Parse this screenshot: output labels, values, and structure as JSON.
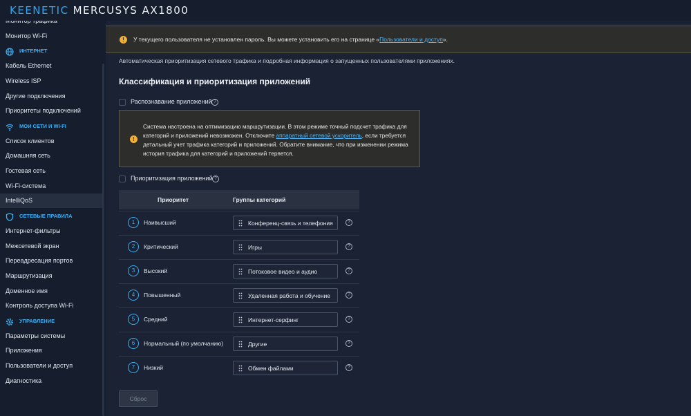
{
  "brand": {
    "part1": "KEENETIC",
    "part2": "MERCUSYS AX1800"
  },
  "sidebar": {
    "items": [
      {
        "type": "item",
        "label": "Монитор трафика"
      },
      {
        "type": "item",
        "label": "Монитор Wi-Fi"
      },
      {
        "type": "section",
        "label": "ИНТЕРНЕТ",
        "icon": "globe-icon"
      },
      {
        "type": "item",
        "label": "Кабель Ethernet"
      },
      {
        "type": "item",
        "label": "Wireless ISP"
      },
      {
        "type": "item",
        "label": "Другие подключения"
      },
      {
        "type": "item",
        "label": "Приоритеты подключений"
      },
      {
        "type": "section",
        "label": "МОИ СЕТИ И WI-FI",
        "icon": "wifi-icon"
      },
      {
        "type": "item",
        "label": "Список клиентов"
      },
      {
        "type": "item",
        "label": "Домашняя сеть"
      },
      {
        "type": "item",
        "label": "Гостевая сеть"
      },
      {
        "type": "item",
        "label": "Wi-Fi-система"
      },
      {
        "type": "item",
        "label": "IntelliQoS",
        "active": true
      },
      {
        "type": "section",
        "label": "СЕТЕВЫЕ ПРАВИЛА",
        "icon": "shield-icon"
      },
      {
        "type": "item",
        "label": "Интернет-фильтры"
      },
      {
        "type": "item",
        "label": "Межсетевой экран"
      },
      {
        "type": "item",
        "label": "Переадресация портов"
      },
      {
        "type": "item",
        "label": "Маршрутизация"
      },
      {
        "type": "item",
        "label": "Доменное имя"
      },
      {
        "type": "item",
        "label": "Контроль доступа Wi-Fi"
      },
      {
        "type": "section",
        "label": "УПРАВЛЕНИЕ",
        "icon": "gear-icon"
      },
      {
        "type": "item",
        "label": "Параметры системы"
      },
      {
        "type": "item",
        "label": "Приложения"
      },
      {
        "type": "item",
        "label": "Пользователи и доступ"
      },
      {
        "type": "item",
        "label": "Диагностика"
      }
    ]
  },
  "warning": {
    "text_before": "У текущего пользователя не установлен пароль. Вы можете установить его на странице «",
    "link": "Пользователи и доступ",
    "text_after": "»."
  },
  "description": "Автоматическая приоритизация сетевого трафика и подробная информация о запущенных пользователями приложениях.",
  "section_title": "Классификация и приоритизация приложений",
  "app_recognition": {
    "label": "Распознавание приложений",
    "checked": false
  },
  "note": {
    "text_before": "Система настроена на оптимизацию маршрутизации. В этом режиме точный подсчет трафика для категорий и приложений невозможен. Отключите ",
    "link": "аппаратный сетевой ускоритель",
    "text_after": ", если требуется детальный учет трафика категорий и приложений. Обратите внимание, что при изменении режима история трафика для категорий и приложений теряется."
  },
  "app_priority": {
    "label": "Приоритизация приложений",
    "checked": false
  },
  "table": {
    "col_priority": "Приоритет",
    "col_groups": "Группы категорий",
    "rows": [
      {
        "num": "1",
        "priority": "Наивысший",
        "group": "Конференц-связь и телефония"
      },
      {
        "num": "2",
        "priority": "Критический",
        "group": "Игры"
      },
      {
        "num": "3",
        "priority": "Высокий",
        "group": "Потоковое видео и аудио"
      },
      {
        "num": "4",
        "priority": "Повышенный",
        "group": "Удаленная работа и обучение"
      },
      {
        "num": "5",
        "priority": "Средний",
        "group": "Интернет-серфинг"
      },
      {
        "num": "6",
        "priority": "Нормальный (по умолчанию)",
        "group": "Другие"
      },
      {
        "num": "7",
        "priority": "Низкий",
        "group": "Обмен файлами"
      }
    ]
  },
  "reset_button": "Сброс",
  "colors": {
    "accent": "#3ab0f5",
    "warning": "#f0b037",
    "background": "#1a2233",
    "sidebar": "#161e2d"
  }
}
